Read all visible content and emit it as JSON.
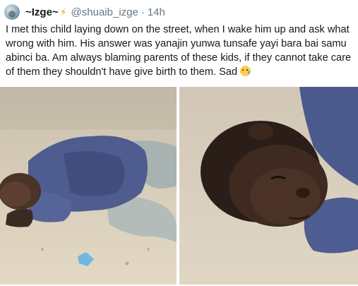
{
  "tweet": {
    "display_name": "~Izge~",
    "handle": "@shuaib_izge",
    "separator": "·",
    "time": "14h",
    "text": "I met this child laying down on the street, when I wake him up and ask what wrong with him. His answer was yanajin yunwa tunsafe yayi bara bai samu abinci ba. Am always blaming parents of these kids, if they cannot take care of them they shouldn't have give birth to them. Sad"
  },
  "icons": {
    "avatar": "profile-avatar",
    "name_badge": "lightning-bolt-icon",
    "text_emoji": "crying-face-emoji"
  },
  "colors": {
    "text": "#14171a",
    "muted": "#657786",
    "sand": "#d9ccb3",
    "robe_blue": "#4a5a8c"
  }
}
